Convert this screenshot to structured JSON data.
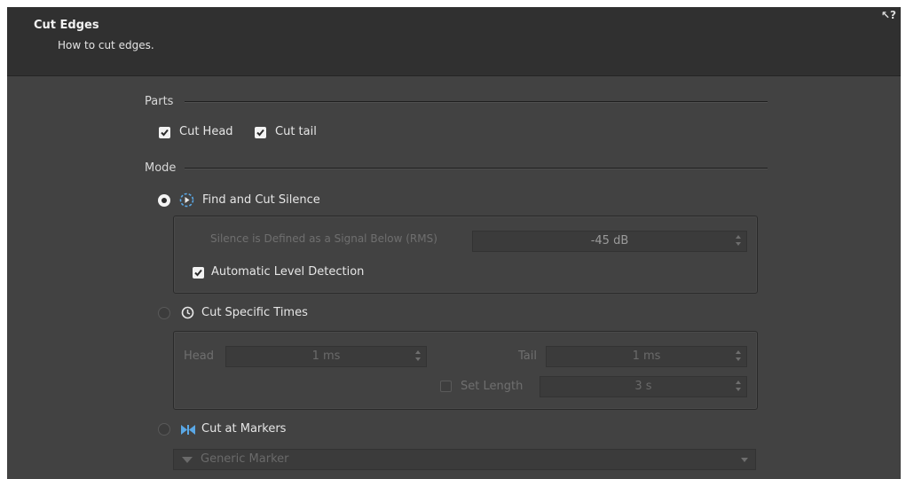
{
  "header": {
    "title": "Cut Edges",
    "subtitle": "How to cut edges.",
    "help_icon": "↖?"
  },
  "parts": {
    "label": "Parts",
    "cut_head": {
      "label": "Cut Head",
      "checked": true
    },
    "cut_tail": {
      "label": "Cut tail",
      "checked": true
    }
  },
  "mode": {
    "label": "Mode",
    "find_silence": {
      "label": "Find and Cut Silence",
      "selected": true,
      "threshold_label": "Silence is Defined as a Signal Below (RMS)",
      "threshold_value": "-45 dB",
      "auto_detect_label": "Automatic Level Detection",
      "auto_detect_checked": true
    },
    "specific_times": {
      "label": "Cut Specific Times",
      "selected": false,
      "head_label": "Head",
      "head_value": "1 ms",
      "tail_label": "Tail",
      "tail_value": "1 ms",
      "set_length_label": "Set Length",
      "set_length_checked": false,
      "set_length_value": "3 s"
    },
    "markers": {
      "label": "Cut at Markers",
      "selected": false,
      "marker_type": "Generic Marker"
    }
  },
  "colors": {
    "bg": "#424242",
    "header_bg": "#303030",
    "accent_blue": "#5aa8e6"
  }
}
